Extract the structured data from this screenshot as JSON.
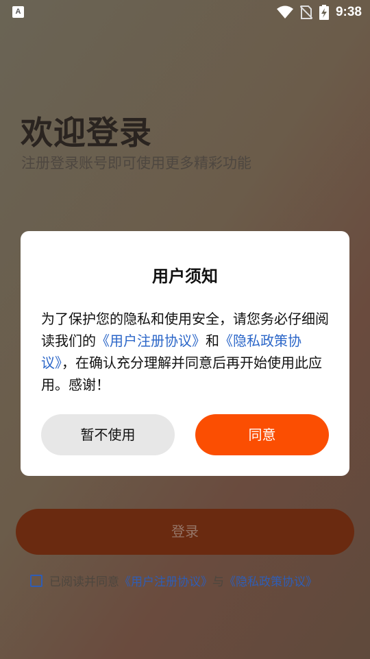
{
  "status_bar": {
    "app_icon_letter": "A",
    "time": "9:38"
  },
  "welcome": {
    "title": "欢迎登录",
    "subtitle": "注册登录账号即可使用更多精彩功能"
  },
  "login": {
    "button_label": "登录",
    "agree_prefix": "已阅读并同意",
    "user_agreement": "《用户注册协议》",
    "and": "与",
    "privacy_agreement": "《隐私政策协议》"
  },
  "dialog": {
    "title": "用户须知",
    "body_part1": "为了保护您的隐私和使用安全，请您务必仔细阅读我们的",
    "link1": "《用户注册协议》",
    "body_part2": "和",
    "link2": "《隐私政策协议》",
    "body_part3": "，在确认充分理解并同意后再开始使用此应用。感谢！",
    "decline_label": "暂不使用",
    "agree_label": "同意"
  },
  "colors": {
    "accent": "#fb4e02",
    "link": "#2b66c8",
    "login_button_dim": "#6a2a10"
  }
}
